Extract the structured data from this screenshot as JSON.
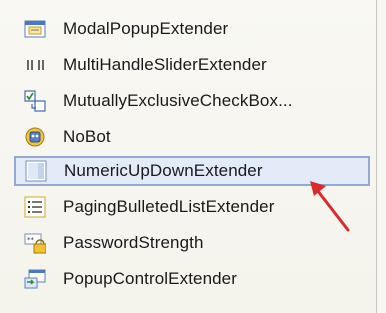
{
  "toolbox": {
    "items": [
      {
        "label": "ModalPopupExtender",
        "icon": "modal-popup-icon"
      },
      {
        "label": "MultiHandleSliderExtender",
        "icon": "multi-handle-slider-icon"
      },
      {
        "label": "MutuallyExclusiveCheckBox...",
        "icon": "exclusive-checkbox-icon"
      },
      {
        "label": "NoBot",
        "icon": "nobot-icon"
      },
      {
        "label": "NumericUpDownExtender",
        "icon": "numeric-updown-icon"
      },
      {
        "label": "PagingBulletedListExtender",
        "icon": "bulleted-list-icon"
      },
      {
        "label": "PasswordStrength",
        "icon": "password-lock-icon"
      },
      {
        "label": "PopupControlExtender",
        "icon": "popup-control-icon"
      }
    ],
    "selected_index": 4
  },
  "colors": {
    "selection_bg": "#e3ebf8",
    "selection_border": "#93a9cf",
    "arrow": "#d92b2b"
  }
}
